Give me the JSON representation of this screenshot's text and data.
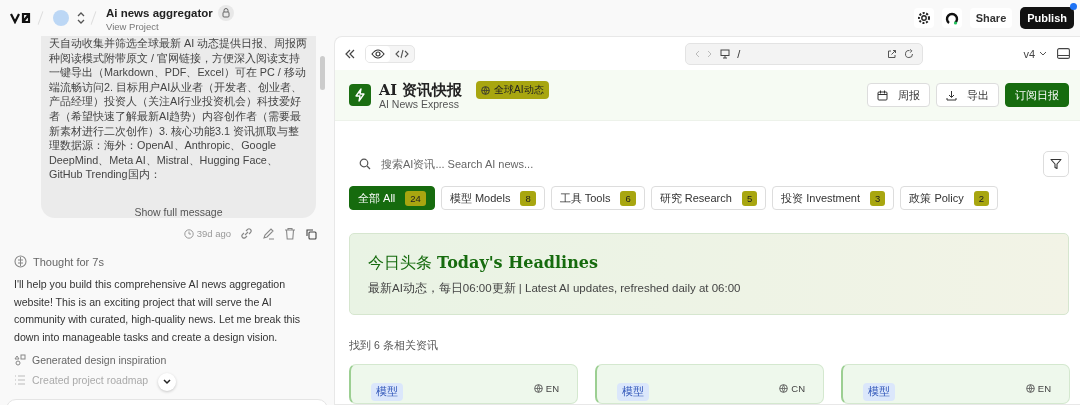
{
  "topbar": {
    "project_title": "Ai news aggregator",
    "project_link": "View Project",
    "share": "Share",
    "publish": "Publish"
  },
  "chat": {
    "message": "天自动收集并筛选全球最新 AI 动态提供日报、周报两种阅读模式附带原文 / 官网链接，方便深入阅读支持一键导出（Markdown、PDF、Excel）可在 PC / 移动端流畅访问2. 目标用户AI从业者（开发者、创业者、产品经理）投资人（关注AI行业投资机会）科技爱好者（希望快速了解最新AI趋势）内容创作者（需要最新素材进行二次创作）3. 核心功能3.1 资讯抓取与整理数据源：海外：OpenAI、Anthropic、Google DeepMind、Meta AI、Mistral、Hugging Face、GitHub Trending国内：",
    "show_full": "Show full message",
    "time": "39d ago",
    "thought": "Thought for 7s",
    "reply": "I'll help you build this comprehensive AI news aggregation website! This is an exciting project that will serve the AI community with curated, high-quality news. Let me break this down into manageable tasks and create a design vision.",
    "steps": [
      {
        "kind": "design",
        "label": "Generated design inspiration"
      },
      {
        "kind": "list",
        "label": "Created project roadmap"
      }
    ]
  },
  "preview": {
    "url": "/",
    "version": "v4",
    "site": {
      "title": "AI 资讯快报",
      "subtitle": "AI News Express",
      "badge": "全球AI动态",
      "buttons": [
        {
          "kind": "calendar",
          "label": "周报"
        },
        {
          "kind": "download",
          "label": "导出"
        },
        {
          "kind": "primary",
          "label": "订阅日报"
        }
      ],
      "search_placeholder": "搜索AI资讯... Search AI news...",
      "tabs": [
        {
          "label": "全部 All",
          "count": "24",
          "selected": true
        },
        {
          "label": "模型 Models",
          "count": "8",
          "selected": false
        },
        {
          "label": "工具 Tools",
          "count": "6",
          "selected": false
        },
        {
          "label": "研究 Research",
          "count": "5",
          "selected": false
        },
        {
          "label": "投资 Investment",
          "count": "3",
          "selected": false
        },
        {
          "label": "政策 Policy",
          "count": "2",
          "selected": false
        }
      ],
      "headline": {
        "title_cn": "今日头条",
        "title_en": "Today's Headlines",
        "subtitle": "最新AI动态，每日06:00更新 | Latest AI updates, refreshed daily at 06:00"
      },
      "result_count": "找到 6 条相关资讯",
      "cards": [
        {
          "tag": "模型",
          "lang": "EN"
        },
        {
          "tag": "模型",
          "lang": "CN"
        },
        {
          "tag": "模型",
          "lang": "EN"
        }
      ]
    }
  }
}
